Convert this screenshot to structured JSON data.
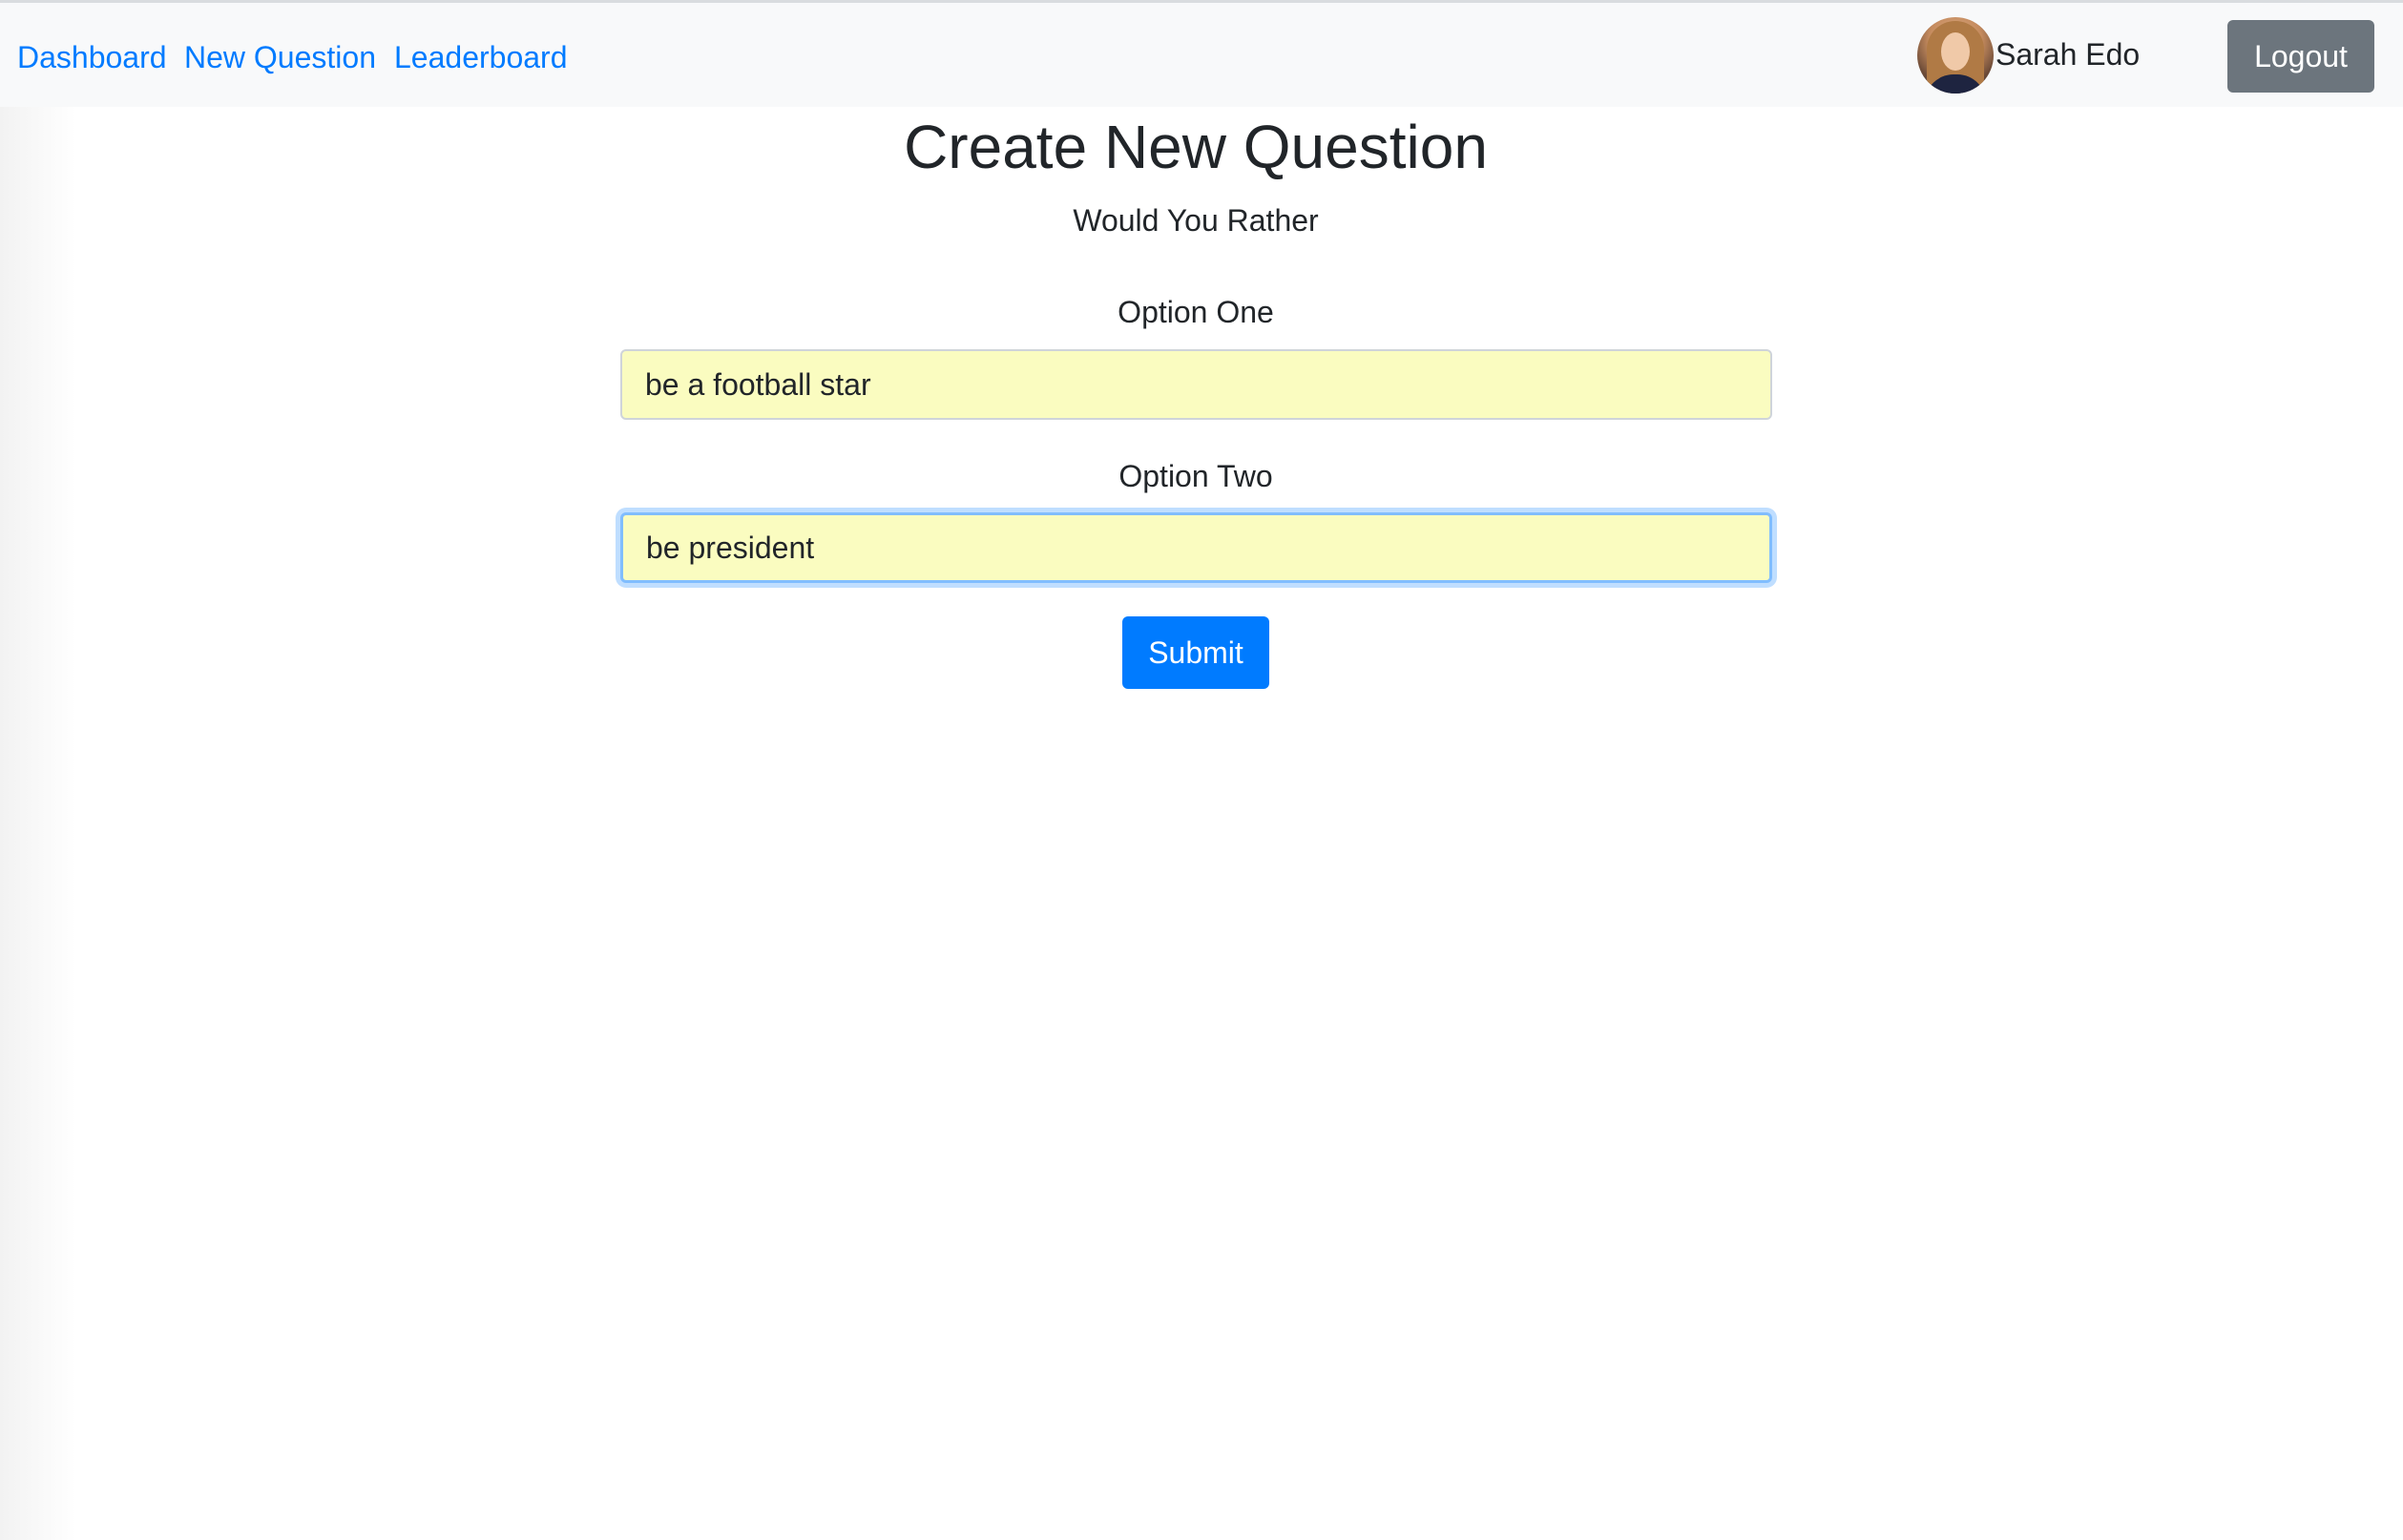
{
  "nav": {
    "links": [
      "Dashboard",
      "New Question",
      "Leaderboard"
    ],
    "user_name": "Sarah Edo",
    "logout_label": "Logout",
    "avatar_icon": "user-avatar-photo"
  },
  "main": {
    "title": "Create New Question",
    "subtitle": "Would You Rather",
    "option_one_label": "Option One",
    "option_one_value": "be a football star",
    "option_two_label": "Option Two",
    "option_two_value": "be president",
    "submit_label": "Submit"
  },
  "colors": {
    "link": "#007bff",
    "navbar_bg": "#f8f9fa",
    "primary_button": "#007bff",
    "secondary_button": "#6c757d",
    "input_autofill_bg": "#fafcc0",
    "focus_ring": "#80bdff"
  }
}
